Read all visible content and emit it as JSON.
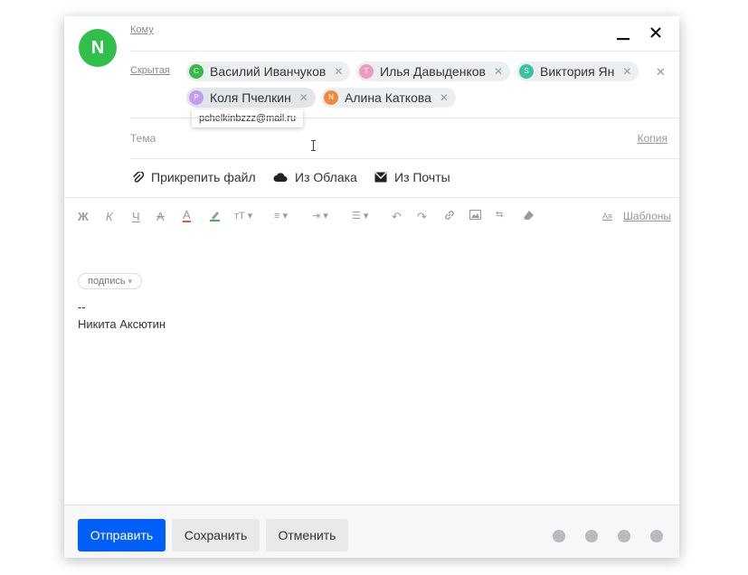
{
  "sender": {
    "initial": "N"
  },
  "fields": {
    "to_label": "Кому",
    "bcc_label": "Скрытая",
    "subject_placeholder": "Тема",
    "copy_label": "Копия"
  },
  "recipients": [
    {
      "initial": "С",
      "name": "Василий Иванчуков",
      "color": "#38b94a"
    },
    {
      "initial": "Т",
      "name": "Илья Давыденков",
      "color": "#ef9ac0"
    },
    {
      "initial": "S",
      "name": "Виктория Ян",
      "color": "#38c4a3"
    },
    {
      "initial": "P",
      "name": "Коля Пчелкин",
      "color": "#c39bef"
    },
    {
      "initial": "N",
      "name": "Алина Каткова",
      "color": "#f08a3a"
    }
  ],
  "tooltip": {
    "email": "pchelkinbzzz@mail.ru"
  },
  "attachments": {
    "file": "Прикрепить файл",
    "cloud": "Из Облака",
    "mail": "Из Почты"
  },
  "toolbar": {
    "templates_abbr": "Ая",
    "templates_label": "Шаблоны"
  },
  "body": {
    "signature_chip": "подпись",
    "dashes": "--",
    "signature_name": "Никита Аксютин"
  },
  "footer": {
    "send": "Отправить",
    "save": "Сохранить",
    "cancel": "Отменить"
  }
}
